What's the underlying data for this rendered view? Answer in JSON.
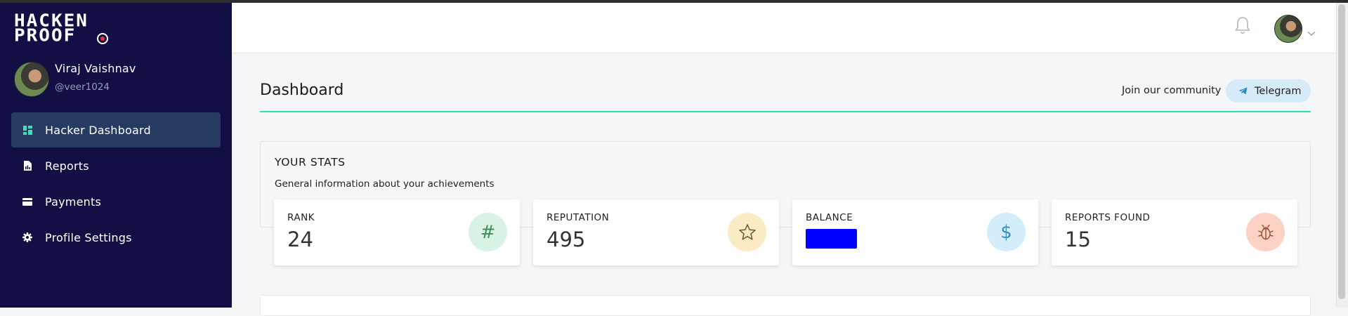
{
  "brand": {
    "logo_line1": "HACKEN",
    "logo_line2": "PROOF"
  },
  "user": {
    "name": "Viraj Vaishnav",
    "handle": "@veer1024"
  },
  "sidebar": {
    "items": [
      {
        "label": "Hacker Dashboard",
        "icon": "dashboard-icon",
        "active": true
      },
      {
        "label": "Reports",
        "icon": "report-file-icon",
        "active": false
      },
      {
        "label": "Payments",
        "icon": "credit-card-icon",
        "active": false
      },
      {
        "label": "Profile Settings",
        "icon": "gear-icon",
        "active": false
      }
    ]
  },
  "header": {
    "notifications_icon": "bell-icon"
  },
  "page": {
    "title": "Dashboard",
    "community_label": "Join our community",
    "telegram_label": "Telegram"
  },
  "stats": {
    "title": "YOUR STATS",
    "subtitle": "General information about your achievements",
    "cards": [
      {
        "label": "RANK",
        "value": "24",
        "icon": "hash-icon",
        "icon_bg": "#d8f3e3",
        "icon_color": "#3e8f5e"
      },
      {
        "label": "REPUTATION",
        "value": "495",
        "icon": "star-icon",
        "icon_bg": "#fbecc6",
        "icon_color": "#6e5a2b"
      },
      {
        "label": "BALANCE",
        "value": "",
        "icon": "dollar-icon",
        "icon_bg": "#d3eefa",
        "icon_color": "#3b8fb8"
      },
      {
        "label": "REPORTS FOUND",
        "value": "15",
        "icon": "bug-icon",
        "icon_bg": "#fbd2c3",
        "icon_color": "#a0533a"
      }
    ]
  },
  "colors": {
    "sidebar_bg": "#120f45",
    "active_item_bg": "#273a62",
    "accent_line": "#2fe0b0",
    "telegram_btn_bg": "#d5ecf8",
    "redaction": "#0000ff"
  }
}
